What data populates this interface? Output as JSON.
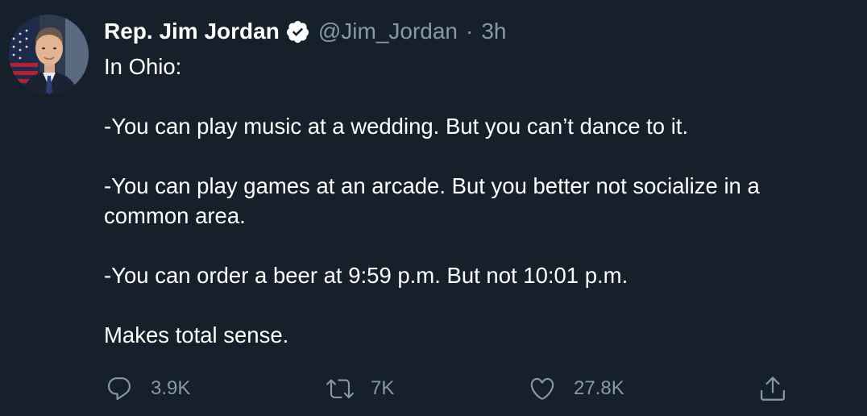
{
  "tweet": {
    "display_name": "Rep. Jim Jordan",
    "handle": "@Jim_Jordan",
    "separator": "·",
    "timestamp": "3h",
    "verified_icon": "verified-badge-icon",
    "avatar": "profile-photo",
    "text_lines": [
      "In Ohio:",
      "",
      "-You can play music at a wedding. But you can’t dance to it.",
      "",
      "-You can play games at an arcade. But you better not socialize in a common area.",
      "",
      "-You can order a beer at 9:59 p.m. But not 10:01 p.m.",
      "",
      "Makes total sense."
    ],
    "actions": {
      "reply": {
        "icon": "reply-icon",
        "count": "3.9K"
      },
      "retweet": {
        "icon": "retweet-icon",
        "count": "7K"
      },
      "like": {
        "icon": "heart-icon",
        "count": "27.8K"
      },
      "share": {
        "icon": "share-icon"
      }
    }
  },
  "colors": {
    "background": "#15202b",
    "primary_text": "#ffffff",
    "secondary_text": "#8899a6"
  }
}
